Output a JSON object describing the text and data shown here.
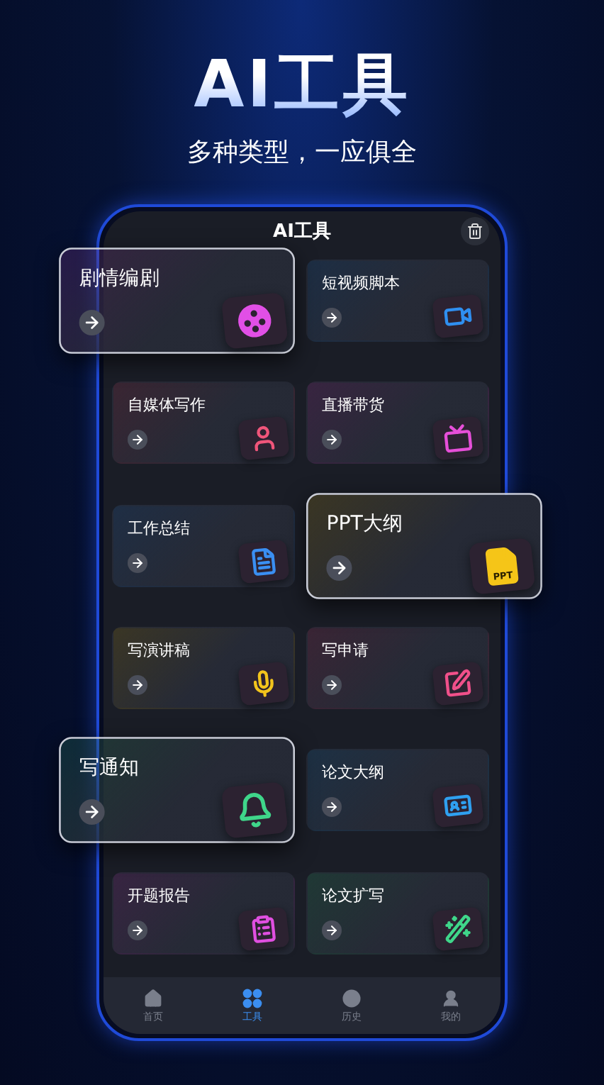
{
  "headline": "AI工具",
  "subtitle": "多种类型，一应俱全",
  "screen": {
    "title": "AI工具"
  },
  "cards": [
    {
      "title": "剧情编剧",
      "featured": true,
      "color": "#e14fe6"
    },
    {
      "title": "短视频脚本",
      "featured": false,
      "color": "#2f8ff0"
    },
    {
      "title": "自媒体写作",
      "featured": false,
      "color": "#f0557a"
    },
    {
      "title": "直播带货",
      "featured": false,
      "color": "#e64fd8"
    },
    {
      "title": "工作总结",
      "featured": false,
      "color": "#3a8ff2"
    },
    {
      "title": "PPT大纲",
      "featured": true,
      "color": "#f5c518",
      "icon_text": "PPT"
    },
    {
      "title": "写演讲稿",
      "featured": false,
      "color": "#f2c41c"
    },
    {
      "title": "写申请",
      "featured": false,
      "color": "#f0508a"
    },
    {
      "title": "写通知",
      "featured": true,
      "color": "#3fd68a"
    },
    {
      "title": "论文大纲",
      "featured": false,
      "color": "#2fa0f0"
    },
    {
      "title": "开题报告",
      "featured": false,
      "color": "#e04fe0"
    },
    {
      "title": "论文扩写",
      "featured": false,
      "color": "#3fd68a"
    }
  ],
  "tabs": [
    {
      "label": "首页",
      "selected": false
    },
    {
      "label": "工具",
      "selected": true
    },
    {
      "label": "历史",
      "selected": false
    },
    {
      "label": "我的",
      "selected": false
    }
  ]
}
